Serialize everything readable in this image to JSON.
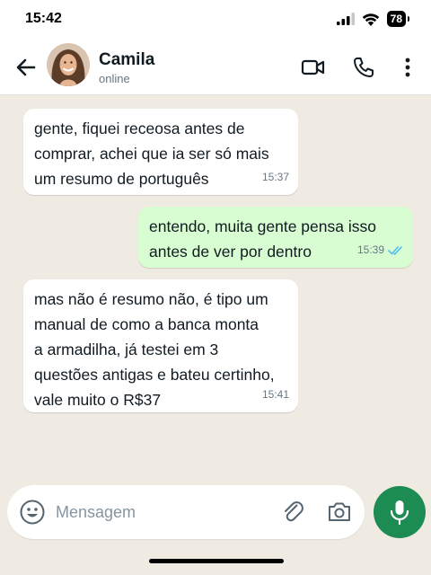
{
  "status_bar": {
    "time": "15:42",
    "battery": "78"
  },
  "header": {
    "contact_name": "Camila",
    "contact_status": "online",
    "icons": [
      "back-arrow-icon",
      "video-call-icon",
      "phone-icon",
      "more-vert-icon"
    ]
  },
  "messages": [
    {
      "direction": "in",
      "text": "gente, fiquei receosa antes de\ncomprar, achei que ia ser só mais\num resumo de português",
      "time": "15:37"
    },
    {
      "direction": "out",
      "text": "entendo, muita gente pensa isso\nantes de ver por dentro",
      "time": "15:39",
      "read": true
    },
    {
      "direction": "in",
      "text": "mas não é resumo não, é tipo um\nmanual de como a banca monta\na armadilha, já testei em 3\nquestões antigas e bateu certinho,\nvale muito o R$37",
      "time": "15:41"
    }
  ],
  "composer": {
    "placeholder": "Mensagem"
  },
  "colors": {
    "accent": "#1c8c52",
    "outgoing_bubble": "#d9fdd3",
    "background": "#efeae2",
    "read_ticks": "#53bdeb"
  }
}
